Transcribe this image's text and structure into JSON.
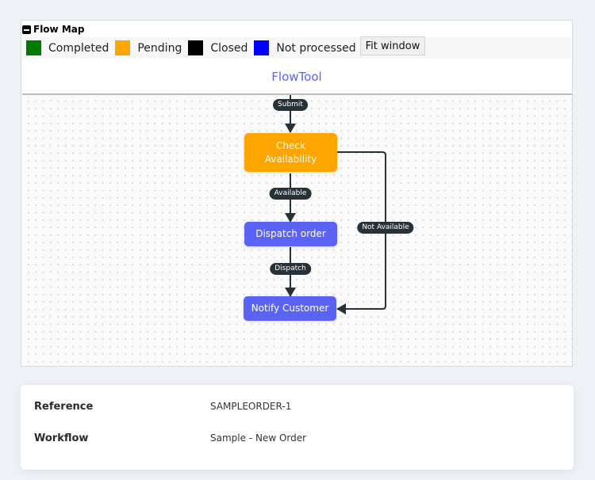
{
  "panel": {
    "title": "Flow Map",
    "legend": [
      {
        "label": "Completed",
        "color": "#007a00"
      },
      {
        "label": "Pending",
        "color": "#ffa500"
      },
      {
        "label": "Closed",
        "color": "#000000"
      },
      {
        "label": "Not processed",
        "color": "#0000ff"
      }
    ],
    "fit_button_label": "Fit window",
    "tool_title": "FlowTool"
  },
  "flow": {
    "nodes": [
      {
        "id": "check",
        "label": "Check Availability",
        "status": "Pending",
        "color": "#ffa500"
      },
      {
        "id": "dispatch",
        "label": "Dispatch order",
        "status": "Not processed",
        "color": "#5b63f5"
      },
      {
        "id": "notify",
        "label": "Notify Customer",
        "status": "Not processed",
        "color": "#5b63f5"
      }
    ],
    "edges": [
      {
        "from": "start",
        "to": "check",
        "label": "Submit"
      },
      {
        "from": "check",
        "to": "dispatch",
        "label": "Available"
      },
      {
        "from": "dispatch",
        "to": "notify",
        "label": "Dispatch"
      },
      {
        "from": "check",
        "to": "notify",
        "label": "Not Available"
      }
    ]
  },
  "details": [
    {
      "key": "Reference",
      "value": "SAMPLEORDER-1"
    },
    {
      "key": "Workflow",
      "value": "Sample - New Order"
    }
  ]
}
